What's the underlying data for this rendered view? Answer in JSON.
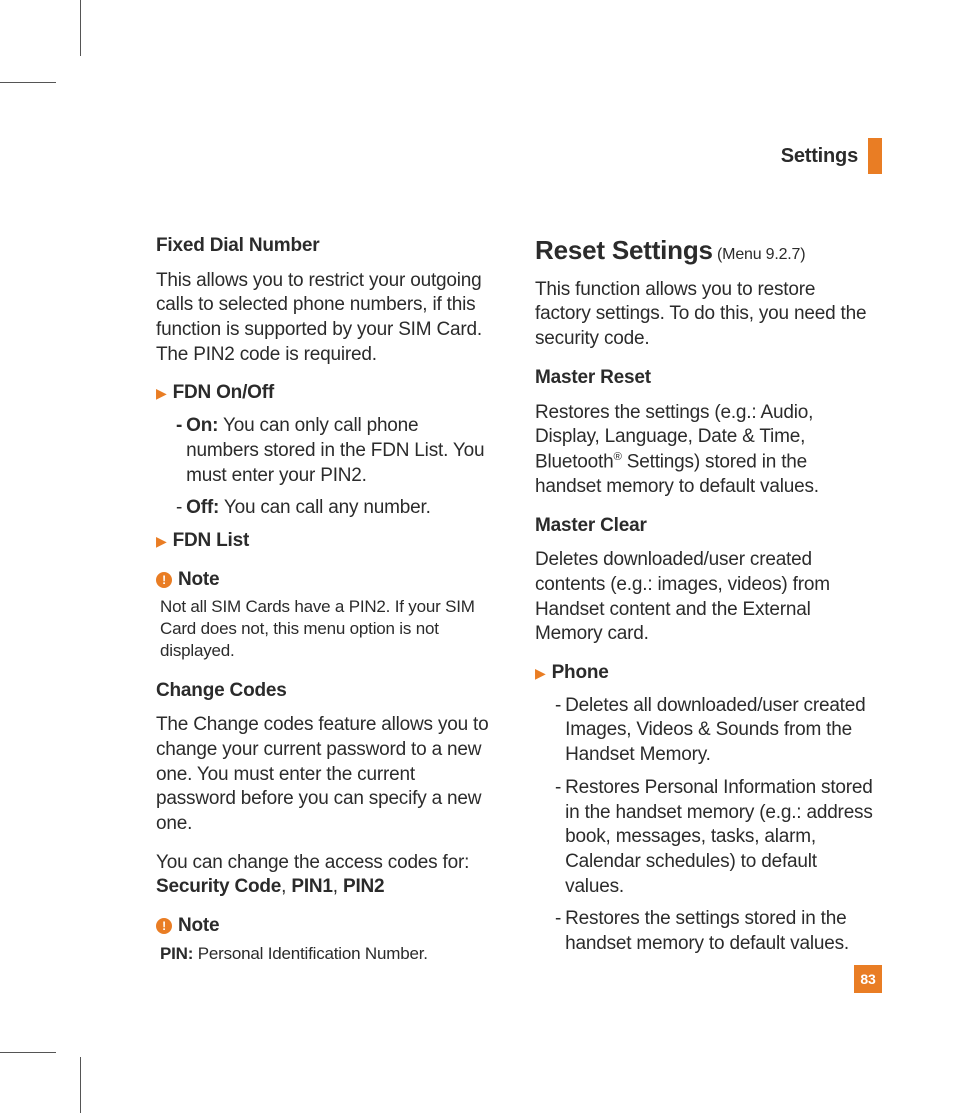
{
  "header": {
    "title": "Settings"
  },
  "page_number": "83",
  "left": {
    "fdn_heading": "Fixed Dial Number",
    "fdn_intro": "This allows you to restrict your outgoing calls to selected phone numbers, if this function is supported by your SIM Card. The PIN2 code is required.",
    "bullet1_label": "FDN On/Off",
    "on_label": "On:",
    "on_text": " You can only call phone numbers stored in the FDN List. You must enter your PIN2.",
    "off_label": "Off:",
    "off_text": " You can call any number.",
    "bullet2_label": "FDN List",
    "note1_title": "Note",
    "note1_body": "Not all SIM Cards have a PIN2. If your SIM Card does not, this menu option is not displayed.",
    "change_heading": "Change Codes",
    "change_p1": "The Change codes feature allows you to change your current password to a new one. You must enter the current password before you can specify a new one.",
    "change_p2_pre": "You can change the access codes for: ",
    "codes": {
      "a": "Security Code",
      "sep1": ", ",
      "b": "PIN1",
      "sep2": ", ",
      "c": "PIN2"
    },
    "note2_title": "Note",
    "note2_label": "PIN:",
    "note2_body": " Personal Identification Number."
  },
  "right": {
    "reset_title": "Reset Settings",
    "reset_menu": " (Menu 9.2.7)",
    "reset_intro": "This function allows you to restore factory settings. To do this, you need the security code.",
    "mr_heading": "Master Reset",
    "mr_body_pre": "Restores the settings (e.g.: Audio, Display, Language, Date & Time, Bluetooth",
    "mr_body_post": " Settings) stored in the handset memory to default values.",
    "mc_heading": "Master Clear",
    "mc_body": "Deletes downloaded/user created contents (e.g.: images, videos) from Handset content and the External Memory card.",
    "phone_label": "Phone",
    "phone_items": [
      "Deletes all downloaded/user created Images, Videos & Sounds from the Handset Memory.",
      "Restores Personal Information stored in the handset memory (e.g.: address book, messages, tasks, alarm, Calendar schedules) to default values.",
      "Restores the settings stored in the handset memory to default values."
    ]
  }
}
